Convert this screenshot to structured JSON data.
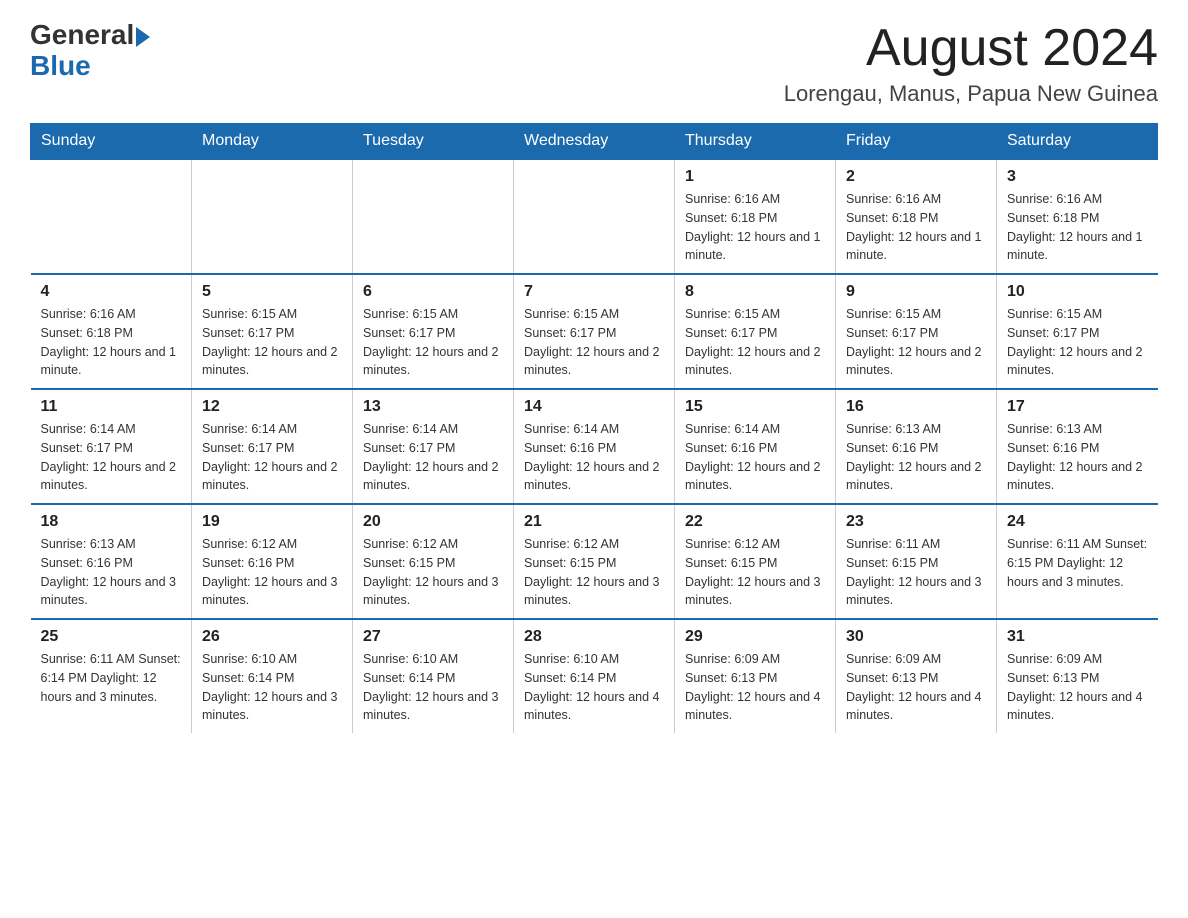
{
  "header": {
    "logo_general": "General",
    "logo_blue": "Blue",
    "month": "August 2024",
    "location": "Lorengau, Manus, Papua New Guinea"
  },
  "days_of_week": [
    "Sunday",
    "Monday",
    "Tuesday",
    "Wednesday",
    "Thursday",
    "Friday",
    "Saturday"
  ],
  "weeks": [
    {
      "days": [
        {
          "num": "",
          "info": ""
        },
        {
          "num": "",
          "info": ""
        },
        {
          "num": "",
          "info": ""
        },
        {
          "num": "",
          "info": ""
        },
        {
          "num": "1",
          "info": "Sunrise: 6:16 AM\nSunset: 6:18 PM\nDaylight: 12 hours and 1 minute."
        },
        {
          "num": "2",
          "info": "Sunrise: 6:16 AM\nSunset: 6:18 PM\nDaylight: 12 hours and 1 minute."
        },
        {
          "num": "3",
          "info": "Sunrise: 6:16 AM\nSunset: 6:18 PM\nDaylight: 12 hours and 1 minute."
        }
      ]
    },
    {
      "days": [
        {
          "num": "4",
          "info": "Sunrise: 6:16 AM\nSunset: 6:18 PM\nDaylight: 12 hours and 1 minute."
        },
        {
          "num": "5",
          "info": "Sunrise: 6:15 AM\nSunset: 6:17 PM\nDaylight: 12 hours and 2 minutes."
        },
        {
          "num": "6",
          "info": "Sunrise: 6:15 AM\nSunset: 6:17 PM\nDaylight: 12 hours and 2 minutes."
        },
        {
          "num": "7",
          "info": "Sunrise: 6:15 AM\nSunset: 6:17 PM\nDaylight: 12 hours and 2 minutes."
        },
        {
          "num": "8",
          "info": "Sunrise: 6:15 AM\nSunset: 6:17 PM\nDaylight: 12 hours and 2 minutes."
        },
        {
          "num": "9",
          "info": "Sunrise: 6:15 AM\nSunset: 6:17 PM\nDaylight: 12 hours and 2 minutes."
        },
        {
          "num": "10",
          "info": "Sunrise: 6:15 AM\nSunset: 6:17 PM\nDaylight: 12 hours and 2 minutes."
        }
      ]
    },
    {
      "days": [
        {
          "num": "11",
          "info": "Sunrise: 6:14 AM\nSunset: 6:17 PM\nDaylight: 12 hours and 2 minutes."
        },
        {
          "num": "12",
          "info": "Sunrise: 6:14 AM\nSunset: 6:17 PM\nDaylight: 12 hours and 2 minutes."
        },
        {
          "num": "13",
          "info": "Sunrise: 6:14 AM\nSunset: 6:17 PM\nDaylight: 12 hours and 2 minutes."
        },
        {
          "num": "14",
          "info": "Sunrise: 6:14 AM\nSunset: 6:16 PM\nDaylight: 12 hours and 2 minutes."
        },
        {
          "num": "15",
          "info": "Sunrise: 6:14 AM\nSunset: 6:16 PM\nDaylight: 12 hours and 2 minutes."
        },
        {
          "num": "16",
          "info": "Sunrise: 6:13 AM\nSunset: 6:16 PM\nDaylight: 12 hours and 2 minutes."
        },
        {
          "num": "17",
          "info": "Sunrise: 6:13 AM\nSunset: 6:16 PM\nDaylight: 12 hours and 2 minutes."
        }
      ]
    },
    {
      "days": [
        {
          "num": "18",
          "info": "Sunrise: 6:13 AM\nSunset: 6:16 PM\nDaylight: 12 hours and 3 minutes."
        },
        {
          "num": "19",
          "info": "Sunrise: 6:12 AM\nSunset: 6:16 PM\nDaylight: 12 hours and 3 minutes."
        },
        {
          "num": "20",
          "info": "Sunrise: 6:12 AM\nSunset: 6:15 PM\nDaylight: 12 hours and 3 minutes."
        },
        {
          "num": "21",
          "info": "Sunrise: 6:12 AM\nSunset: 6:15 PM\nDaylight: 12 hours and 3 minutes."
        },
        {
          "num": "22",
          "info": "Sunrise: 6:12 AM\nSunset: 6:15 PM\nDaylight: 12 hours and 3 minutes."
        },
        {
          "num": "23",
          "info": "Sunrise: 6:11 AM\nSunset: 6:15 PM\nDaylight: 12 hours and 3 minutes."
        },
        {
          "num": "24",
          "info": "Sunrise: 6:11 AM\nSunset: 6:15 PM\nDaylight: 12 hours and 3 minutes."
        }
      ]
    },
    {
      "days": [
        {
          "num": "25",
          "info": "Sunrise: 6:11 AM\nSunset: 6:14 PM\nDaylight: 12 hours and 3 minutes."
        },
        {
          "num": "26",
          "info": "Sunrise: 6:10 AM\nSunset: 6:14 PM\nDaylight: 12 hours and 3 minutes."
        },
        {
          "num": "27",
          "info": "Sunrise: 6:10 AM\nSunset: 6:14 PM\nDaylight: 12 hours and 3 minutes."
        },
        {
          "num": "28",
          "info": "Sunrise: 6:10 AM\nSunset: 6:14 PM\nDaylight: 12 hours and 4 minutes."
        },
        {
          "num": "29",
          "info": "Sunrise: 6:09 AM\nSunset: 6:13 PM\nDaylight: 12 hours and 4 minutes."
        },
        {
          "num": "30",
          "info": "Sunrise: 6:09 AM\nSunset: 6:13 PM\nDaylight: 12 hours and 4 minutes."
        },
        {
          "num": "31",
          "info": "Sunrise: 6:09 AM\nSunset: 6:13 PM\nDaylight: 12 hours and 4 minutes."
        }
      ]
    }
  ]
}
